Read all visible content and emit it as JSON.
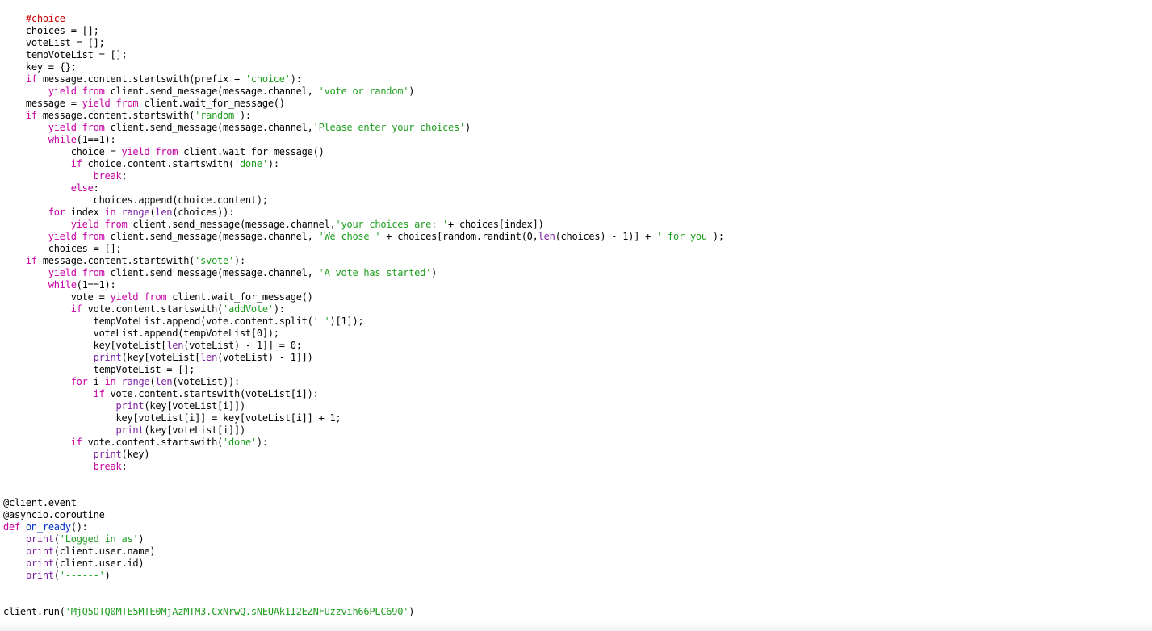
{
  "editor": {
    "lines": [
      [
        {
          "t": "    "
        },
        {
          "t": "#choice",
          "c": "comment"
        }
      ],
      [
        {
          "t": "    choices = [];"
        }
      ],
      [
        {
          "t": "    voteList = [];"
        }
      ],
      [
        {
          "t": "    tempVoteList = [];"
        }
      ],
      [
        {
          "t": "    key = {};"
        }
      ],
      [
        {
          "t": "    "
        },
        {
          "t": "if",
          "c": "keyword"
        },
        {
          "t": " message.content.startswith(prefix + "
        },
        {
          "t": "'choice'",
          "c": "string"
        },
        {
          "t": "):"
        }
      ],
      [
        {
          "t": "        "
        },
        {
          "t": "yield from",
          "c": "keyword"
        },
        {
          "t": " client.send_message(message.channel, "
        },
        {
          "t": "'vote or random'",
          "c": "string"
        },
        {
          "t": ")"
        }
      ],
      [
        {
          "t": "    message = "
        },
        {
          "t": "yield from",
          "c": "keyword"
        },
        {
          "t": " client.wait_for_message()"
        }
      ],
      [
        {
          "t": "    "
        },
        {
          "t": "if",
          "c": "keyword"
        },
        {
          "t": " message.content.startswith("
        },
        {
          "t": "'random'",
          "c": "string"
        },
        {
          "t": "):"
        }
      ],
      [
        {
          "t": "        "
        },
        {
          "t": "yield from",
          "c": "keyword"
        },
        {
          "t": " client.send_message(message.channel,"
        },
        {
          "t": "'Please enter your choices'",
          "c": "string"
        },
        {
          "t": ")"
        }
      ],
      [
        {
          "t": "        "
        },
        {
          "t": "while",
          "c": "keyword"
        },
        {
          "t": "(1==1):"
        }
      ],
      [
        {
          "t": "            choice = "
        },
        {
          "t": "yield from",
          "c": "keyword"
        },
        {
          "t": " client.wait_for_message()"
        }
      ],
      [
        {
          "t": "            "
        },
        {
          "t": "if",
          "c": "keyword"
        },
        {
          "t": " choice.content.startswith("
        },
        {
          "t": "'done'",
          "c": "string"
        },
        {
          "t": "):"
        }
      ],
      [
        {
          "t": "                "
        },
        {
          "t": "break",
          "c": "keyword"
        },
        {
          "t": ";"
        }
      ],
      [
        {
          "t": "            "
        },
        {
          "t": "else",
          "c": "keyword"
        },
        {
          "t": ":"
        }
      ],
      [
        {
          "t": "                choices.append(choice.content);"
        }
      ],
      [
        {
          "t": "        "
        },
        {
          "t": "for",
          "c": "keyword"
        },
        {
          "t": " index "
        },
        {
          "t": "in",
          "c": "keyword"
        },
        {
          "t": " "
        },
        {
          "t": "range",
          "c": "builtin"
        },
        {
          "t": "("
        },
        {
          "t": "len",
          "c": "builtin"
        },
        {
          "t": "(choices)):"
        }
      ],
      [
        {
          "t": "            "
        },
        {
          "t": "yield from",
          "c": "keyword"
        },
        {
          "t": " client.send_message(message.channel,"
        },
        {
          "t": "'your choices are: '",
          "c": "string"
        },
        {
          "t": "+ choices[index])"
        }
      ],
      [
        {
          "t": "        "
        },
        {
          "t": "yield from",
          "c": "keyword"
        },
        {
          "t": " client.send_message(message.channel, "
        },
        {
          "t": "'We chose '",
          "c": "string"
        },
        {
          "t": " + choices[random.randint(0,"
        },
        {
          "t": "len",
          "c": "builtin"
        },
        {
          "t": "(choices) - 1)] + "
        },
        {
          "t": "' for you'",
          "c": "string"
        },
        {
          "t": ");"
        }
      ],
      [
        {
          "t": "        choices = [];"
        }
      ],
      [
        {
          "t": "    "
        },
        {
          "t": "if",
          "c": "keyword"
        },
        {
          "t": " message.content.startswith("
        },
        {
          "t": "'svote'",
          "c": "string"
        },
        {
          "t": "):"
        }
      ],
      [
        {
          "t": "        "
        },
        {
          "t": "yield from",
          "c": "keyword"
        },
        {
          "t": " client.send_message(message.channel, "
        },
        {
          "t": "'A vote has started'",
          "c": "string"
        },
        {
          "t": ")"
        }
      ],
      [
        {
          "t": "        "
        },
        {
          "t": "while",
          "c": "keyword"
        },
        {
          "t": "(1==1):"
        }
      ],
      [
        {
          "t": "            vote = "
        },
        {
          "t": "yield from",
          "c": "keyword"
        },
        {
          "t": " client.wait_for_message()"
        }
      ],
      [
        {
          "t": "            "
        },
        {
          "t": "if",
          "c": "keyword"
        },
        {
          "t": " vote.content.startswith("
        },
        {
          "t": "'addVote'",
          "c": "string"
        },
        {
          "t": "):"
        }
      ],
      [
        {
          "t": "                tempVoteList.append(vote.content.split("
        },
        {
          "t": "' '",
          "c": "string"
        },
        {
          "t": ")[1]);"
        }
      ],
      [
        {
          "t": "                voteList.append(tempVoteList[0]);"
        }
      ],
      [
        {
          "t": "                key[voteList["
        },
        {
          "t": "len",
          "c": "builtin"
        },
        {
          "t": "(voteList) - 1]] = 0;"
        }
      ],
      [
        {
          "t": "                "
        },
        {
          "t": "print",
          "c": "builtin"
        },
        {
          "t": "(key[voteList["
        },
        {
          "t": "len",
          "c": "builtin"
        },
        {
          "t": "(voteList) - 1]])"
        }
      ],
      [
        {
          "t": "                tempVoteList = [];"
        }
      ],
      [
        {
          "t": "            "
        },
        {
          "t": "for",
          "c": "keyword"
        },
        {
          "t": " i "
        },
        {
          "t": "in",
          "c": "keyword"
        },
        {
          "t": " "
        },
        {
          "t": "range",
          "c": "builtin"
        },
        {
          "t": "("
        },
        {
          "t": "len",
          "c": "builtin"
        },
        {
          "t": "(voteList)):"
        }
      ],
      [
        {
          "t": "                "
        },
        {
          "t": "if",
          "c": "keyword"
        },
        {
          "t": " vote.content.startswith(voteList[i]):"
        }
      ],
      [
        {
          "t": "                    "
        },
        {
          "t": "print",
          "c": "builtin"
        },
        {
          "t": "(key[voteList[i]])"
        }
      ],
      [
        {
          "t": "                    key[voteList[i]] = key[voteList[i]] + 1;"
        }
      ],
      [
        {
          "t": "                    "
        },
        {
          "t": "print",
          "c": "builtin"
        },
        {
          "t": "(key[voteList[i]])"
        }
      ],
      [
        {
          "t": "            "
        },
        {
          "t": "if",
          "c": "keyword"
        },
        {
          "t": " vote.content.startswith("
        },
        {
          "t": "'done'",
          "c": "string"
        },
        {
          "t": "):"
        }
      ],
      [
        {
          "t": "                "
        },
        {
          "t": "print",
          "c": "builtin"
        },
        {
          "t": "(key)"
        }
      ],
      [
        {
          "t": "                "
        },
        {
          "t": "break",
          "c": "keyword"
        },
        {
          "t": ";"
        }
      ],
      [],
      [],
      [
        {
          "t": "@client.event"
        }
      ],
      [
        {
          "t": "@asyncio.coroutine"
        }
      ],
      [
        {
          "t": "def",
          "c": "keyword"
        },
        {
          "t": " "
        },
        {
          "t": "on_ready",
          "c": "def"
        },
        {
          "t": "():"
        }
      ],
      [
        {
          "t": "    "
        },
        {
          "t": "print",
          "c": "builtin"
        },
        {
          "t": "("
        },
        {
          "t": "'Logged in as'",
          "c": "string"
        },
        {
          "t": ")"
        }
      ],
      [
        {
          "t": "    "
        },
        {
          "t": "print",
          "c": "builtin"
        },
        {
          "t": "(client.user.name)"
        }
      ],
      [
        {
          "t": "    "
        },
        {
          "t": "print",
          "c": "builtin"
        },
        {
          "t": "(client.user.id)"
        }
      ],
      [
        {
          "t": "    "
        },
        {
          "t": "print",
          "c": "builtin"
        },
        {
          "t": "("
        },
        {
          "t": "'------'",
          "c": "string"
        },
        {
          "t": ")"
        }
      ],
      [],
      [],
      [
        {
          "t": "client.run("
        },
        {
          "t": "'MjQ5OTQ0MTE5MTE0MjAzMTM3.CxNrwQ.sNEUAk1I2EZNFUzzvih66PLC690'",
          "c": "string"
        },
        {
          "t": ")"
        }
      ]
    ]
  },
  "colors": {
    "keyword": "#c800a4",
    "builtin": "#7b1fa2",
    "string": "#1e9e1e",
    "comment": "#cc0000",
    "def": "#0030c8",
    "plain": "#000000",
    "background": "#ffffff"
  }
}
